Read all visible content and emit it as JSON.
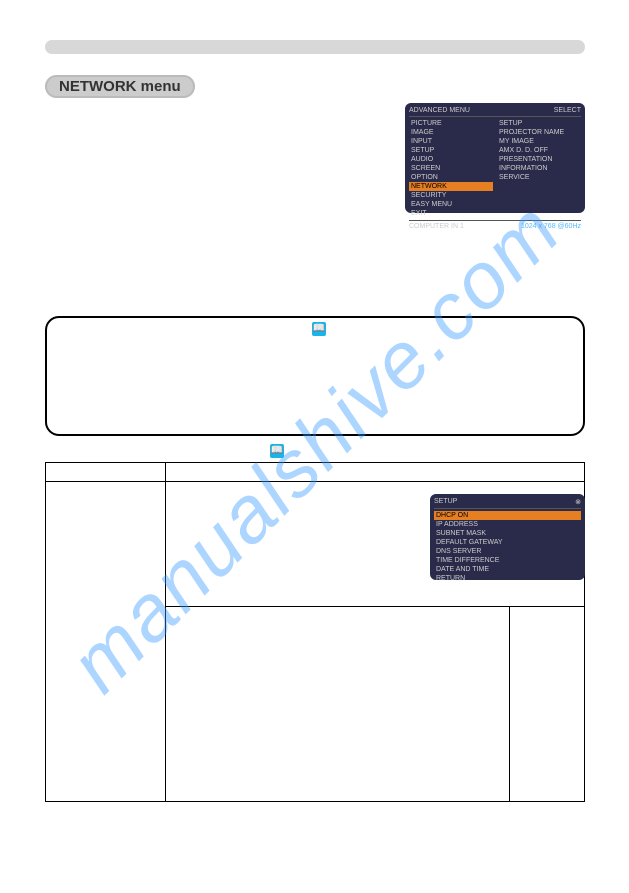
{
  "watermark": "manualshive.com",
  "badge": "NETWORK menu",
  "info_icon": "📖",
  "menu1": {
    "header_left": "ADVANCED MENU",
    "header_right": "SELECT",
    "col1": [
      "PICTURE",
      "IMAGE",
      "INPUT",
      "SETUP",
      "AUDIO",
      "SCREEN",
      "OPTION",
      "NETWORK",
      "SECURITY",
      "EASY MENU",
      "EXIT"
    ],
    "col2": [
      "SETUP",
      "PROJECTOR NAME",
      "MY IMAGE",
      "AMX D. D.          OFF",
      "PRESENTATION",
      "INFORMATION",
      "SERVICE"
    ],
    "footer_left": "COMPUTER IN 1",
    "footer_right": "1024 x 768 @60Hz"
  },
  "menu2": {
    "header_left": "SETUP",
    "rows": [
      "DHCP                          ON",
      "IP ADDRESS",
      "SUBNET MASK",
      "DEFAULT GATEWAY",
      "DNS SERVER",
      "TIME DIFFERENCE",
      "DATE AND TIME",
      "RETURN"
    ]
  }
}
